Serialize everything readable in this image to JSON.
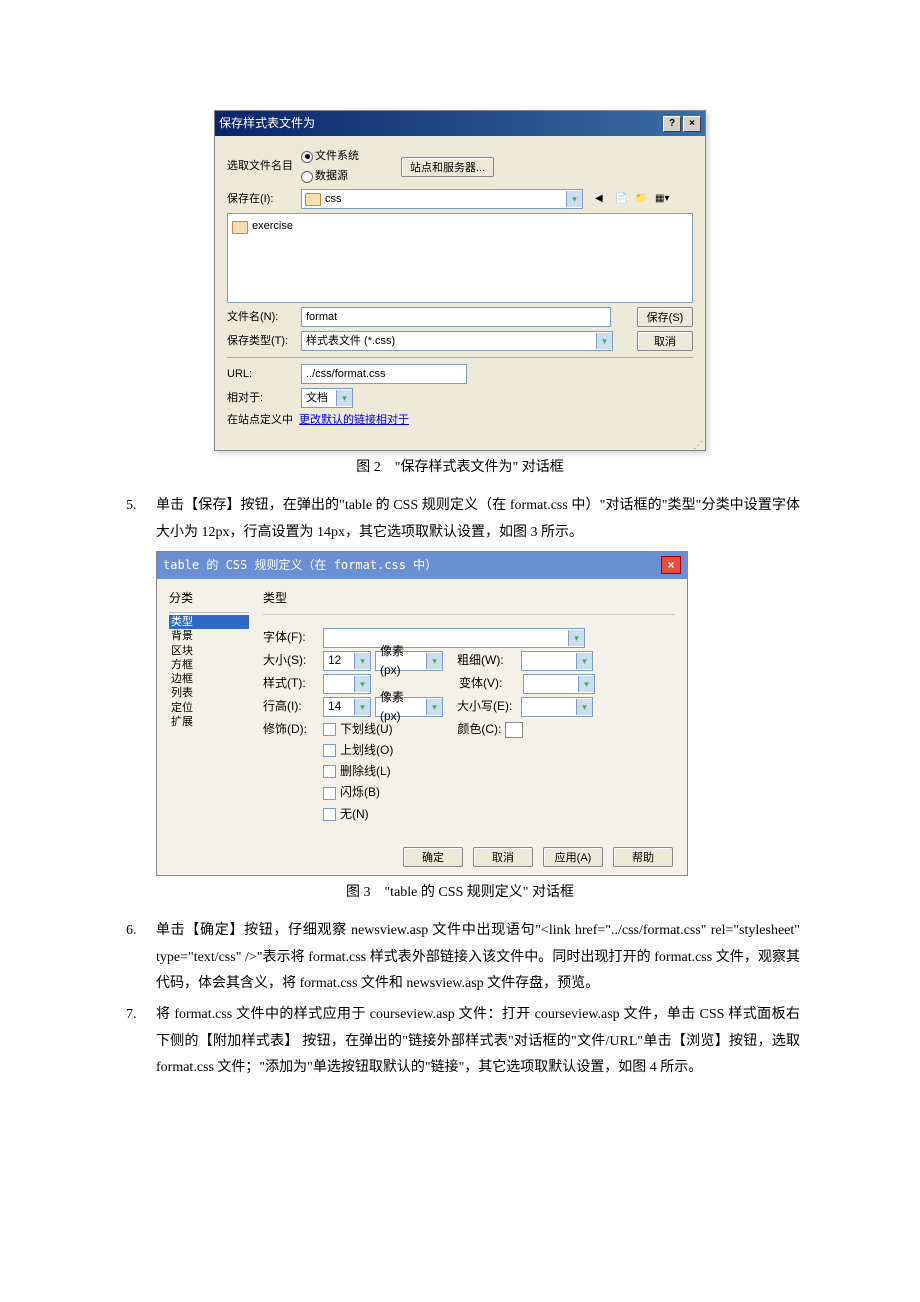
{
  "dialog1": {
    "title": "保存样式表文件为",
    "help_icon": "?",
    "close_icon": "×",
    "rows": {
      "select_label": "选取文件名目",
      "radio1": "文件系统",
      "radio2": "数据源",
      "server_btn": "站点和服务器...",
      "savein_label": "保存在(I):",
      "savein_value": "css",
      "folder_item": "exercise",
      "filename_label": "文件名(N):",
      "filename_value": "format",
      "filetype_label": "保存类型(T):",
      "filetype_value": "样式表文件 (*.css)",
      "save_btn": "保存(S)",
      "cancel_btn": "取消",
      "url_label": "URL:",
      "url_value": "../css/format.css",
      "relative_label": "相对于:",
      "relative_value": "文档",
      "footer_text": "在站点定义中",
      "footer_link": "更改默认的链接相对于"
    }
  },
  "caption1": "图 2　\"保存样式表文件为\" 对话框",
  "step5": "单击【保存】按钮，在弹出的\"table 的 CSS 规则定义（在 format.css 中）\"对话框的\"类型\"分类中设置字体大小为 12px，行高设置为 14px，其它选项取默认设置，如图 3 所示。",
  "dialog2": {
    "title": "table 的 CSS 规则定义（在 format.css 中）",
    "close_icon": "×",
    "cat_title": "分类",
    "cats": [
      "类型",
      "背景",
      "区块",
      "方框",
      "边框",
      "列表",
      "定位",
      "扩展"
    ],
    "props_title": "类型",
    "font_label": "字体(F):",
    "size_label": "大小(S):",
    "size_value": "12",
    "size_unit": "像素(px)",
    "weight_label": "粗细(W):",
    "style_label": "样式(T):",
    "variant_label": "变体(V):",
    "line_label": "行高(I):",
    "line_value": "14",
    "line_unit": "像素(px)",
    "case_label": "大小写(E):",
    "deco_label": "修饰(D):",
    "deco_items": [
      "下划线(U)",
      "上划线(O)",
      "删除线(L)",
      "闪烁(B)",
      "无(N)"
    ],
    "color_label": "颜色(C):",
    "ok": "确定",
    "cancel": "取消",
    "apply": "应用(A)",
    "help": "帮助"
  },
  "caption2": "图 3　\"table 的 CSS 规则定义\" 对话框",
  "step6": "单击【确定】按钮，仔细观察 newsview.asp 文件中出现语句\"<link href=\"../css/format.css\" rel=\"stylesheet\" type=\"text/css\" />\"表示将 format.css 样式表外部链接入该文件中。同时出现打开的 format.css 文件，观察其代码，体会其含义，将 format.css 文件和 newsview.asp 文件存盘，预览。",
  "step7": "将 format.css 文件中的样式应用于 courseview.asp 文件：打开 courseview.asp 文件，单击 CSS 样式面板右下侧的【附加样式表】 按钮，在弹出的\"链接外部样式表\"对话框的\"文件/URL\"单击【浏览】按钮，选取 format.css 文件；\"添加为\"单选按钮取默认的\"链接\"，其它选项取默认设置，如图 4 所示。"
}
